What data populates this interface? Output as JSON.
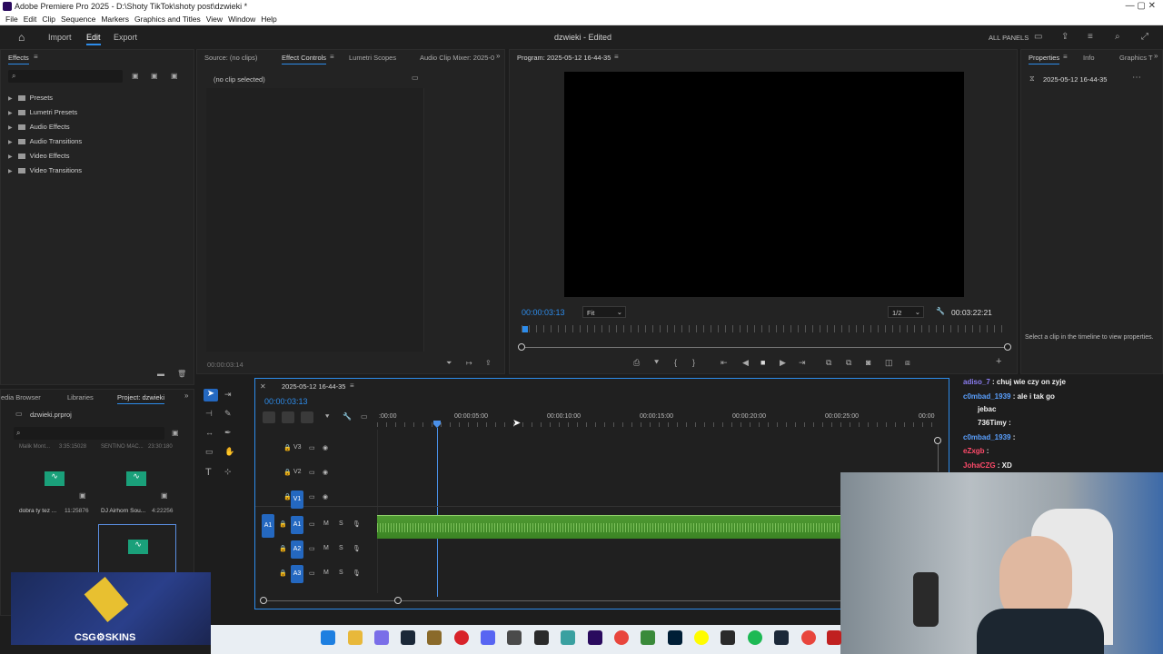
{
  "window": {
    "title": "Adobe Premiere Pro 2025 - D:\\Shoty TikTok\\shoty post\\dzwieki *",
    "controls": "—   ▢   ✕"
  },
  "menu": [
    "File",
    "Edit",
    "Clip",
    "Sequence",
    "Markers",
    "Graphics and Titles",
    "View",
    "Window",
    "Help"
  ],
  "header": {
    "import": "Import",
    "edit": "Edit",
    "export": "Export",
    "doc_title": "dzwieki - Edited",
    "all_panels": "ALL PANELS"
  },
  "effects_panel": {
    "tab": "Effects",
    "items": [
      "Presets",
      "Lumetri Presets",
      "Audio Effects",
      "Audio Transitions",
      "Video Effects",
      "Video Transitions"
    ]
  },
  "source_tabs": [
    "Source: (no clips)",
    "Effect Controls",
    "Lumetri Scopes",
    "Audio Clip Mixer: 2025-0"
  ],
  "effect_controls": {
    "no_clip": "(no clip selected)",
    "timecode": "00:00:03:14"
  },
  "program": {
    "tab": "Program: 2025-05-12 16-44-35",
    "timecode": "00:00:03:13",
    "fit": "Fit",
    "res": "1/2",
    "duration": "00:03:22:21"
  },
  "properties": {
    "tabs": [
      "Properties",
      "Info",
      "Graphics T"
    ],
    "seq_name": "2025-05-12 16-44-35",
    "hint": "Select a clip in the timeline to view properties."
  },
  "project": {
    "tabs": [
      "edia Browser",
      "Libraries",
      "Project: dzwieki"
    ],
    "file": "dzwieki.prproj",
    "clips": [
      {
        "name": "dobra ty tez ...",
        "dur": "11:25876"
      },
      {
        "name": "DJ Airhorn Sou...",
        "dur": "4:22256"
      }
    ],
    "partial": [
      "Malik Mont...",
      "3:35:15028",
      "SENTINO MAC...",
      "23:30:180"
    ]
  },
  "timeline": {
    "tab": "2025-05-12 16-44-35",
    "timecode": "00:00:03:13",
    "ruler": [
      ":00:00",
      "00:00:05:00",
      "00:00:10:00",
      "00:00:15:00",
      "00:00:20:00",
      "00:00:25:00",
      "00:00"
    ],
    "tracks": [
      {
        "id": "V3"
      },
      {
        "id": "V2"
      },
      {
        "id": "V1",
        "src": "V1"
      },
      {
        "id": "A1",
        "src": "A1",
        "m": "M",
        "s": "S"
      },
      {
        "id": "A2",
        "m": "M",
        "s": "S"
      },
      {
        "id": "A3",
        "m": "M",
        "s": "S"
      }
    ]
  },
  "chat": [
    {
      "user": "adiso_7",
      "msg": "chuj wie czy on zyje",
      "color": "#8a7cf0"
    },
    {
      "user": "c0mbad_1939",
      "msg": "ale i tak go",
      "color": "#5aa0ff"
    },
    {
      "user": "",
      "msg": "jebac",
      "color": "#ffffff"
    },
    {
      "user": "736Timy",
      "msg": "",
      "color": "#f0f0f0"
    },
    {
      "user": "c0mbad_1939",
      "msg": "",
      "color": "#5aa0ff"
    },
    {
      "user": "eZxgb",
      "msg": "",
      "color": "#ff4a6a"
    },
    {
      "user": "JohaCZG",
      "msg": "XD",
      "color": "#ff4a6a"
    }
  ],
  "overlay": {
    "brand": "CSG⚙SKINS"
  },
  "colors": {
    "accent": "#2d8ceb",
    "audio": "#3b9a22",
    "track_blue": "#2468c0"
  }
}
